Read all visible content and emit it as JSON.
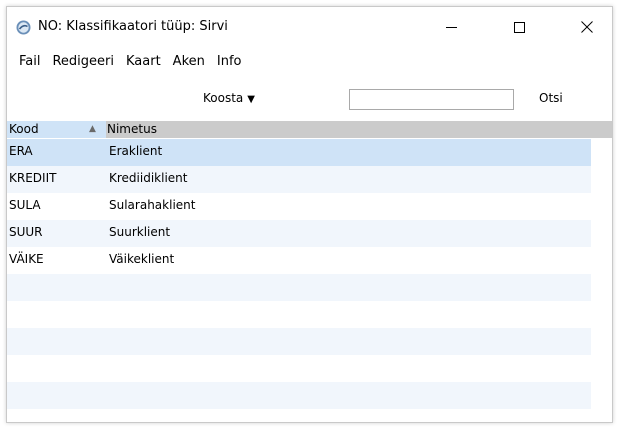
{
  "window": {
    "title": "NO: Klassifikaatori tüüp: Sirvi"
  },
  "menu": [
    "Fail",
    "Redigeeri",
    "Kaart",
    "Aken",
    "Info"
  ],
  "toolbar": {
    "koosta_label": "Koosta",
    "search_value": "",
    "search_button_label": "Otsi"
  },
  "table": {
    "columns": [
      "Kood",
      "Nimetus"
    ],
    "rows": [
      {
        "kood": "ERA",
        "nimetus": "Eraklient"
      },
      {
        "kood": "KREDIIT",
        "nimetus": "Krediidiklient"
      },
      {
        "kood": "SULA",
        "nimetus": "Sularahaklient"
      },
      {
        "kood": "SUUR",
        "nimetus": "Suurklient"
      },
      {
        "kood": "VÄIKE",
        "nimetus": "Väikeklient"
      }
    ],
    "selected_row": 0
  },
  "colors": {
    "selection": "#cfe3f7",
    "alt_row": "#f1f6fc",
    "header": "#cbcbcb"
  }
}
